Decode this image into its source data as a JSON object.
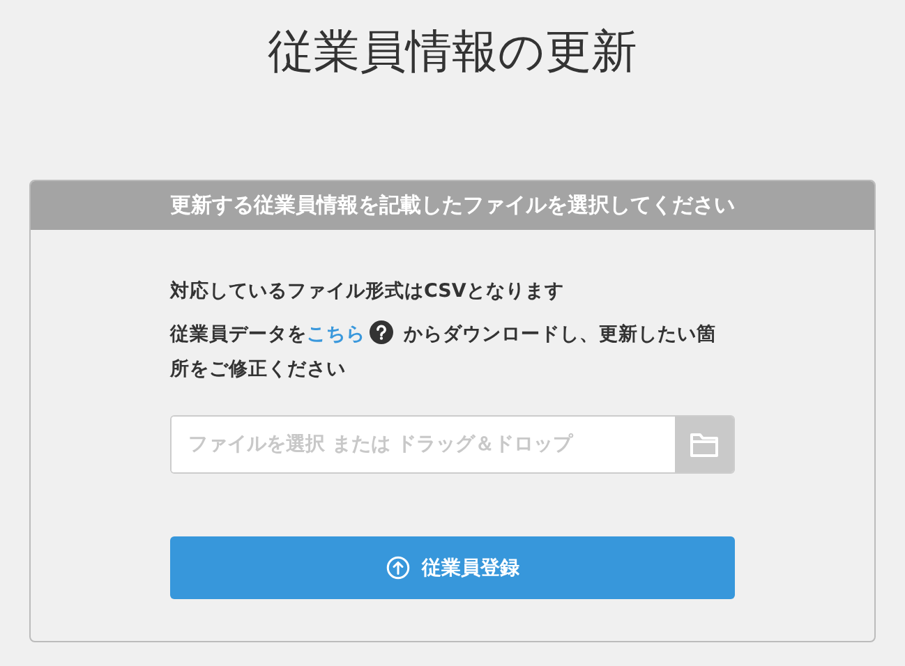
{
  "page_title": "従業員情報の更新",
  "card": {
    "header": "更新する従業員情報を記載したファイルを選択してください",
    "format_note": "対応しているファイル形式はCSVとなります",
    "instruction": {
      "before": "従業員データを",
      "link": "こちら",
      "after": "からダウンロードし、更新したい箇所をご修正ください"
    },
    "file_field": {
      "placeholder": "ファイルを選択 または ドラッグ＆ドロップ"
    },
    "submit_button": "従業員登録"
  }
}
